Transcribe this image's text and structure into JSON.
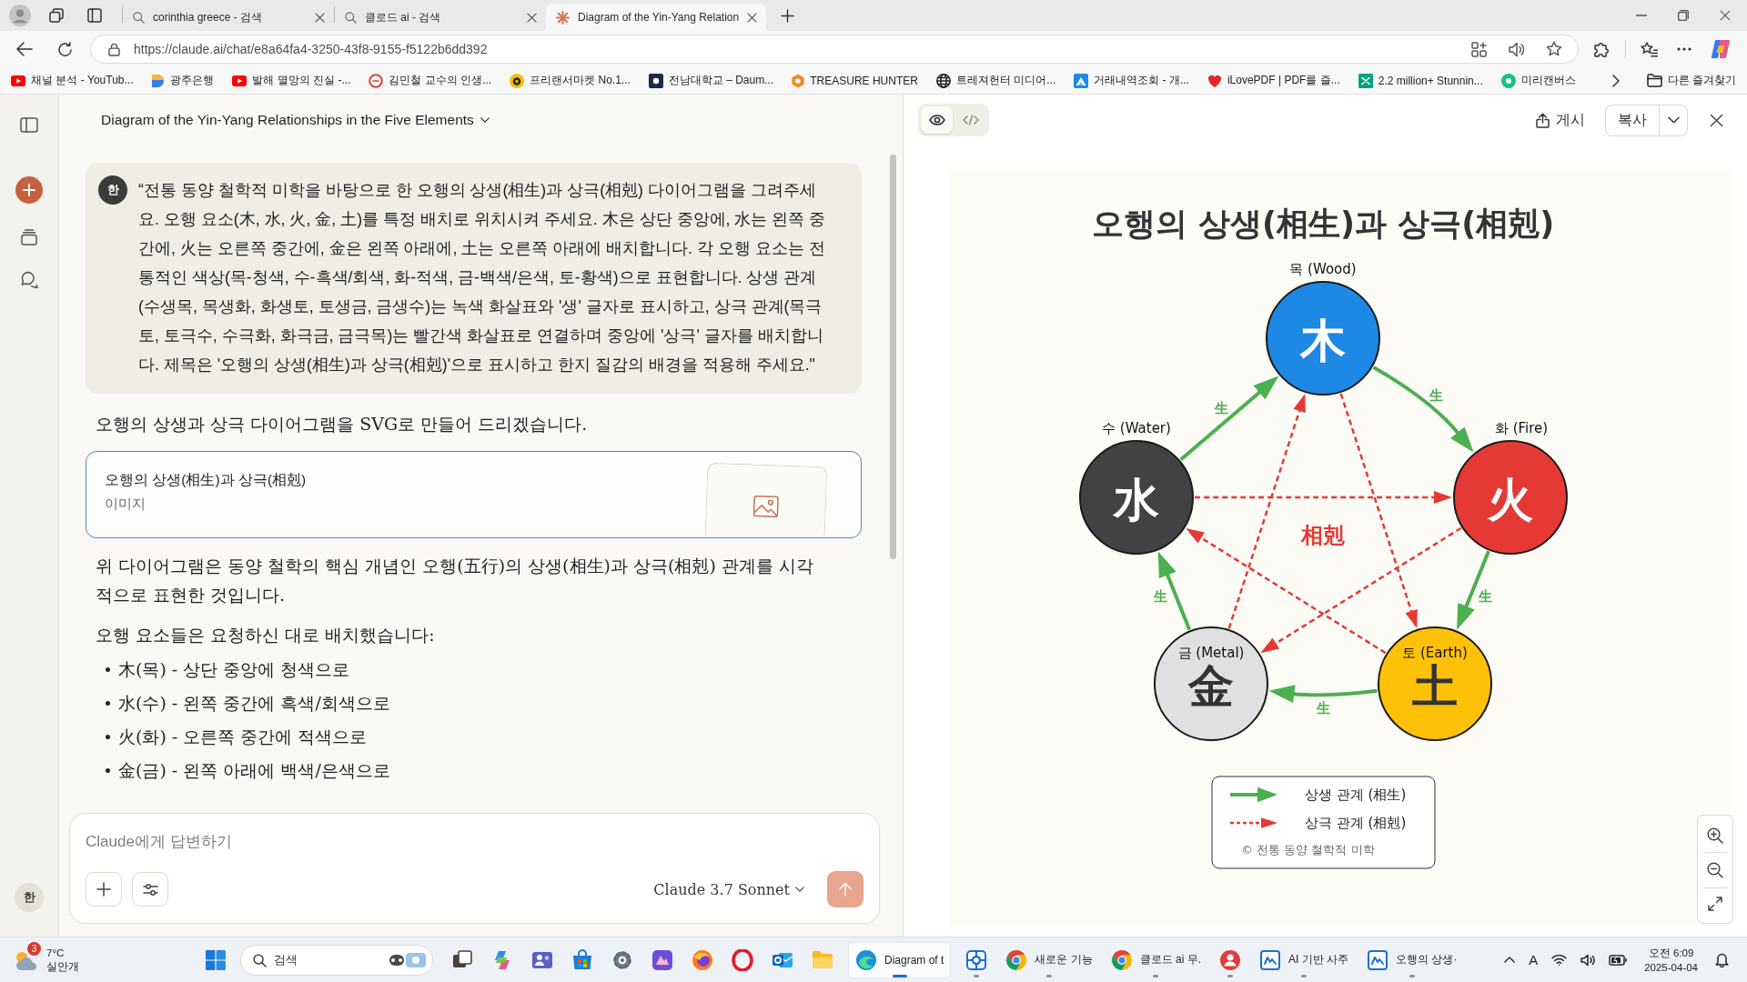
{
  "browser": {
    "tabs": [
      {
        "kind": "search",
        "title": "corinthia greece - 검색",
        "selected": false
      },
      {
        "kind": "search",
        "title": "클로드 ai - 검색",
        "selected": false
      },
      {
        "kind": "site",
        "title": "Diagram of the Yin-Yang Relation",
        "selected": true
      }
    ],
    "url": "https://claude.ai/chat/e8a64fa4-3250-43f8-9155-f5122b6dd392",
    "bookmarks": [
      {
        "kind": "play",
        "label": "채널 분석 - YouTub..."
      },
      {
        "kind": "ribbon",
        "label": "광주은행"
      },
      {
        "kind": "play",
        "label": "발해 멸망의 진실 -..."
      },
      {
        "kind": "ring",
        "label": "김민철 교수의 인생..."
      },
      {
        "kind": "badge",
        "label": "프리랜서마켓 No.1..."
      },
      {
        "kind": "square",
        "label": "전남대학교 – Daum..."
      },
      {
        "kind": "hexagon",
        "label": "TREASURE HUNTER"
      },
      {
        "kind": "globe",
        "label": "트레져헌터 미디어..."
      },
      {
        "kind": "tile",
        "label": "거래내역조회 - 개..."
      },
      {
        "kind": "heart",
        "label": "iLovePDF | PDF를 즐..."
      },
      {
        "kind": "block",
        "label": "2.2 million+ Stunnin..."
      },
      {
        "kind": "circle",
        "label": "미리캔버스"
      }
    ],
    "other_bookmarks": "다른 즐겨찾기"
  },
  "sidebar": {
    "avatar": "한"
  },
  "chat": {
    "title": "Diagram of the Yin-Yang Relationships in the Five Elements",
    "user_message": {
      "avatar": "한",
      "text": "“전통 동양 철학적 미학을 바탕으로 한 오행의 상생(相生)과 상극(相剋) 다이어그램을 그려주세요. 오행 요소(木, 水, 火, 金, 土)를 특정 배치로 위치시켜 주세요. 木은 상단 중앙에, 水는 왼쪽 중간에, 火는 오른쪽 중간에, 金은 왼쪽 아래에, 土는 오른쪽 아래에 배치합니다. 각 오행 요소는 전통적인 색상(목-청색, 수-흑색/회색, 화-적색, 금-백색/은색, 토-황색)으로 표현합니다. 상생 관계(수생목, 목생화, 화생토, 토생금, 금생수)는 녹색 화살표와 '생' 글자로 표시하고, 상극 관계(목극토, 토극수, 수극화, 화극금, 금극목)는 빨간색 화살표로 연결하며 중앙에 '상극' 글자를 배치합니다. 제목은 '오행의 상생(相生)과 상극(相剋)'으로 표시하고 한지 질감의 배경을 적용해 주세요.\""
    },
    "reply_intro": "오행의 상생과 상극 다이어그램을 SVG로 만들어 드리겠습니다.",
    "artifact_card": {
      "title": "오행의 상생(相生)과 상극(相剋)",
      "type": "이미지",
      "selected": true
    },
    "paragraphs": [
      "위 다이어그램은 동양 철학의 핵심 개념인 오행(五行)의 상생(相生)과 상극(相剋) 관계를 시각적으로 표현한 것입니다.",
      "오행 요소들은 요청하신 대로 배치했습니다:"
    ],
    "bullets": [
      "木(목) - 상단 중앙에 청색으로",
      "水(수) - 왼쪽 중간에 흑색/회색으로",
      "火(화) - 오른쪽 중간에 적색으로",
      "金(금) - 왼쪽 아래에 백색/은색으로"
    ],
    "composer": {
      "placeholder": "Claude에게 답변하기",
      "model": "Claude 3.7 Sonnet"
    }
  },
  "artifact": {
    "views": [
      {
        "kind": "preview",
        "selected": true
      },
      {
        "kind": "code",
        "selected": false
      }
    ],
    "publish": "게시",
    "copy": "복사",
    "diagram": {
      "title": "오행의 상생(相生)과 상극(相剋)",
      "center_label": "相剋",
      "nodes": [
        {
          "kind": "wood",
          "label": "목 (Wood)",
          "glyph": "木",
          "color": "#1e88e5",
          "arrows": [
            {
              "kind": "generating",
              "label": "生"
            },
            {
              "kind": "overcoming"
            }
          ]
        },
        {
          "kind": "water",
          "label": "수 (Water)",
          "glyph": "水",
          "color": "#424242",
          "arrows": [
            {
              "kind": "generating",
              "label": "生"
            },
            {
              "kind": "overcoming"
            }
          ]
        },
        {
          "kind": "fire",
          "label": "화 (Fire)",
          "glyph": "火",
          "color": "#e53935",
          "arrows": [
            {
              "kind": "generating",
              "label": "生"
            },
            {
              "kind": "overcoming"
            }
          ]
        },
        {
          "kind": "metal",
          "label": "금 (Metal)",
          "glyph": "金",
          "color": "#e0e0e0",
          "arrows": [
            {
              "kind": "generating",
              "label": "生"
            },
            {
              "kind": "overcoming"
            }
          ]
        },
        {
          "kind": "earth",
          "label": "토 (Earth)",
          "glyph": "土",
          "color": "#ffc107",
          "arrows": [
            {
              "kind": "generating",
              "label": "生"
            },
            {
              "kind": "overcoming"
            }
          ]
        }
      ],
      "legend": [
        {
          "kind": "generating",
          "label": "상생 관계 (相生)"
        },
        {
          "kind": "overcoming",
          "label": "상극 관계 (相剋)"
        }
      ],
      "credit": "© 전통 동양 철학적 미학"
    }
  },
  "taskbar": {
    "weather": {
      "badge": "3",
      "temp": "7°C",
      "condition": "실안개"
    },
    "search_placeholder": "검색",
    "pinned": [
      {
        "kind": "stack"
      },
      {
        "kind": "knot"
      },
      {
        "kind": "people"
      },
      {
        "kind": "bag"
      },
      {
        "kind": "gear"
      },
      {
        "kind": "tile"
      },
      {
        "kind": "flame"
      },
      {
        "kind": "ring"
      },
      {
        "kind": "mail"
      },
      {
        "kind": "folder"
      }
    ],
    "windows": [
      {
        "kind": "swirl",
        "label": "Diagram of t",
        "selected": true
      },
      {
        "kind": "app",
        "selected": false
      },
      {
        "kind": "segments",
        "label": "새로운 기능",
        "selected": false
      },
      {
        "kind": "segments",
        "label": "클로드 ai 무.",
        "selected": false
      },
      {
        "kind": "person",
        "selected": false
      },
      {
        "kind": "note",
        "label": "AI 기반 사주",
        "selected": false
      },
      {
        "kind": "note",
        "label": "오행의 상생·",
        "selected": false
      }
    ],
    "input_indicator": "A",
    "clock": {
      "time": "오전 6:09",
      "date": "2025-04-04"
    }
  }
}
